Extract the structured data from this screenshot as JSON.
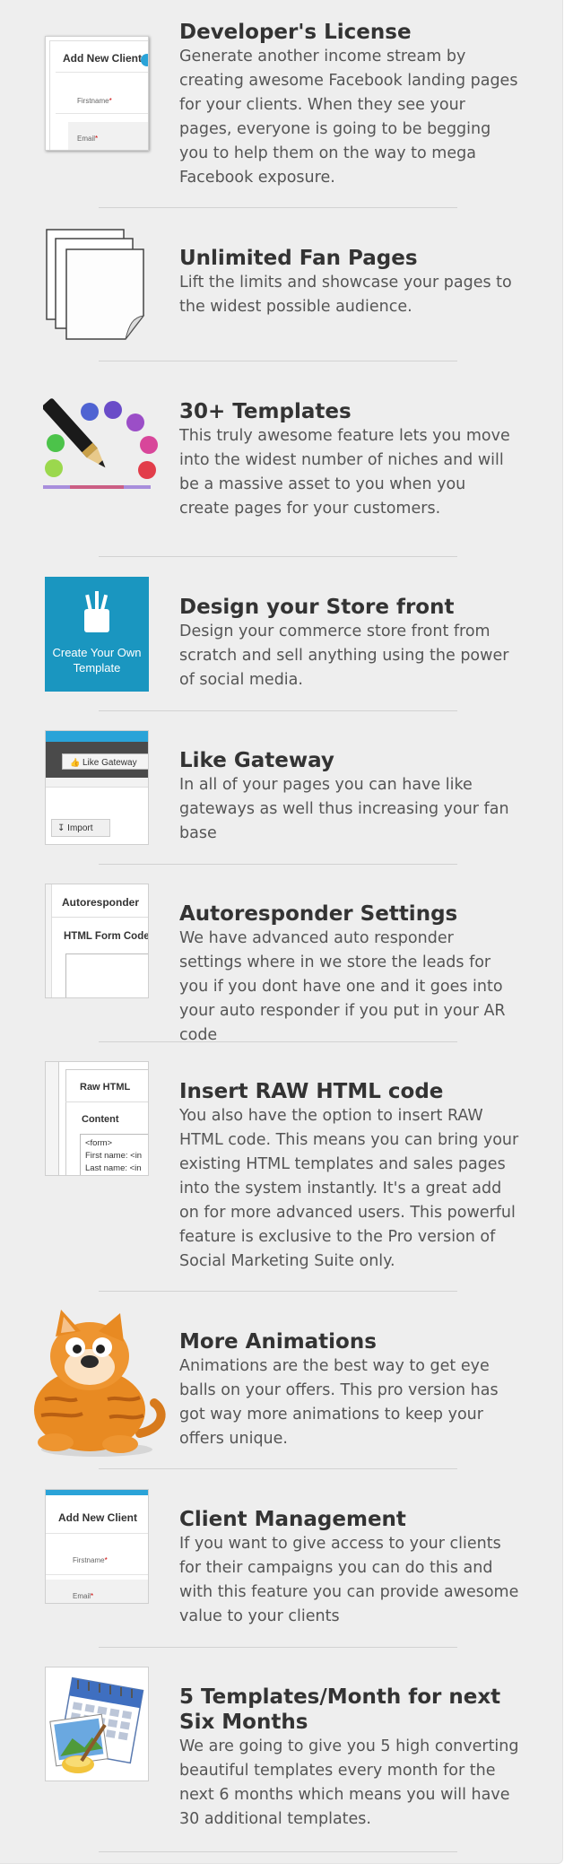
{
  "features": [
    {
      "icon": "client-form-icon",
      "title": "Developer's License",
      "description": "Generate another income stream by creating awesome Facebook landing pages for your clients. When they see your pages, everyone is going to be begging you to help them on the way to mega Facebook exposure."
    },
    {
      "icon": "stacked-pages-icon",
      "title": "Unlimited Fan Pages",
      "description": "Lift the limits and showcase your pages to the widest possible audience."
    },
    {
      "icon": "paint-palette-icon",
      "title": "30+ Templates",
      "description": "This truly awesome feature lets you move into the widest number of niches and will be a massive asset to you when you create pages for your customers."
    },
    {
      "icon": "create-template-icon",
      "title": "Design your Store front",
      "description": "Design your commerce store front from scratch and sell anything using the power of social media."
    },
    {
      "icon": "like-gateway-icon",
      "title": "Like Gateway",
      "description": "In all of your pages you can have like gateways as well thus increasing your fan base"
    },
    {
      "icon": "autoresponder-icon",
      "title": "Autoresponder Settings",
      "description": "We have advanced auto responder settings where in we store the leads for you if you dont have one and it goes into your auto responder if you put in your AR code"
    },
    {
      "icon": "raw-html-icon",
      "title": "Insert RAW HTML code",
      "description": "You also have the option to insert RAW HTML code. This means you can bring your existing HTML templates and sales pages into the system instantly. It's a great add on for more advanced users. This powerful feature is exclusive to the Pro version of Social Marketing Suite only."
    },
    {
      "icon": "cat-mascot-icon",
      "title": "More Animations",
      "description": "Animations are the best way to get eye balls on your offers. This pro version has got way more animations to keep your offers unique."
    },
    {
      "icon": "client-management-icon",
      "title": "Client Management",
      "description": "If you want to give access to your clients for their campaigns you can do this and with this feature you can provide awesome value to your clients"
    },
    {
      "icon": "calendar-icon",
      "title": "5 Templates/Month for next Six Months",
      "description": "We are going to give you 5 high converting beautiful templates every month for the next 6 months which means you will have 30 additional templates."
    }
  ],
  "thumbs": {
    "dev_heading": "Add New Client",
    "dev_firstname": "Firstname",
    "dev_email": "Email",
    "store_label": "Create Your Own Template",
    "like_button": "Like Gateway",
    "import_button": "Import",
    "ar_tab": "Autoresponder",
    "ar_field": "HTML Form Code",
    "raw_tab": "Raw HTML",
    "raw_content": "Content",
    "raw_line1": "<form>",
    "raw_line2": "First name: <in",
    "raw_line3": "Last name: <in",
    "cm_heading": "Add New Client",
    "cm_firstname": "Firstname",
    "cm_email": "Email"
  },
  "colors": {
    "panel_bg": "#eeeeee",
    "title": "#333333",
    "body_text": "#555555",
    "store_blue": "#1a96c0",
    "accent_blue": "#2aa3d8",
    "required_red": "#cc0000"
  }
}
